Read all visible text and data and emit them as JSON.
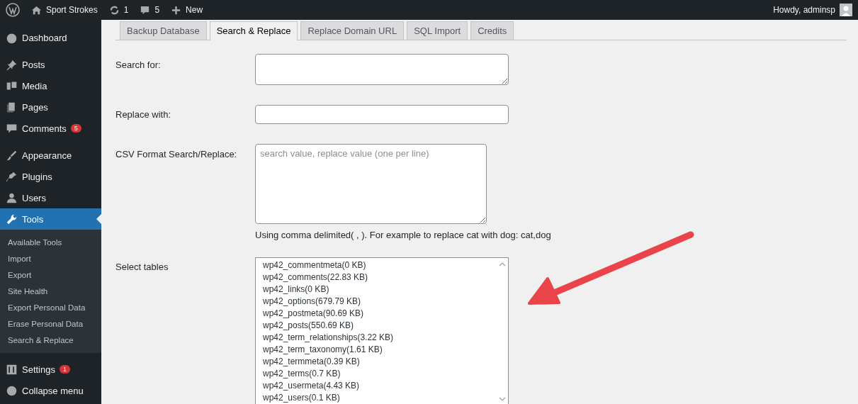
{
  "admin_bar": {
    "site_name": "Sport Strokes",
    "updates": "1",
    "comments": "5",
    "new_label": "New",
    "greeting": "Howdy, adminsp"
  },
  "sidebar": {
    "items": [
      {
        "label": "Dashboard",
        "selected": false
      },
      {
        "label": "Posts",
        "selected": false
      },
      {
        "label": "Media",
        "selected": false
      },
      {
        "label": "Pages",
        "selected": false
      },
      {
        "label": "Comments",
        "selected": false,
        "badge": "5"
      },
      {
        "label": "Appearance",
        "selected": false
      },
      {
        "label": "Plugins",
        "selected": false
      },
      {
        "label": "Users",
        "selected": false
      },
      {
        "label": "Tools",
        "selected": true,
        "children": [
          {
            "label": "Available Tools",
            "selected": false
          },
          {
            "label": "Import",
            "selected": false
          },
          {
            "label": "Export",
            "selected": false
          },
          {
            "label": "Site Health",
            "selected": false
          },
          {
            "label": "Export Personal Data",
            "selected": false
          },
          {
            "label": "Erase Personal Data",
            "selected": false
          },
          {
            "label": "Search & Replace",
            "selected": false
          }
        ]
      },
      {
        "label": "Settings",
        "selected": false,
        "badge": "1"
      },
      {
        "label": "Collapse menu",
        "selected": false
      }
    ]
  },
  "tabs": [
    {
      "label": "Backup Database",
      "selected": false
    },
    {
      "label": "Search & Replace",
      "selected": true
    },
    {
      "label": "Replace Domain URL",
      "selected": false
    },
    {
      "label": "SQL Import",
      "selected": false
    },
    {
      "label": "Credits",
      "selected": false
    }
  ],
  "form": {
    "search_label": "Search for:",
    "replace_label": "Replace with:",
    "csv_label": "CSV Format Search/Replace:",
    "csv_placeholder": "search value, replace value (one per line)",
    "csv_help": "Using comma delimited( , ). For example to replace cat with dog: cat,dog",
    "tables_label": "Select tables",
    "tables": [
      "wp42_commentmeta(0 KB)",
      "wp42_comments(22.83 KB)",
      "wp42_links(0 KB)",
      "wp42_options(679.79 KB)",
      "wp42_postmeta(90.69 KB)",
      "wp42_posts(550.69 KB)",
      "wp42_term_relationships(3.22 KB)",
      "wp42_term_taxonomy(1.61 KB)",
      "wp42_termmeta(0.39 KB)",
      "wp42_terms(0.7 KB)",
      "wp42_usermeta(4.43 KB)",
      "wp42_users(0.1 KB)"
    ]
  }
}
